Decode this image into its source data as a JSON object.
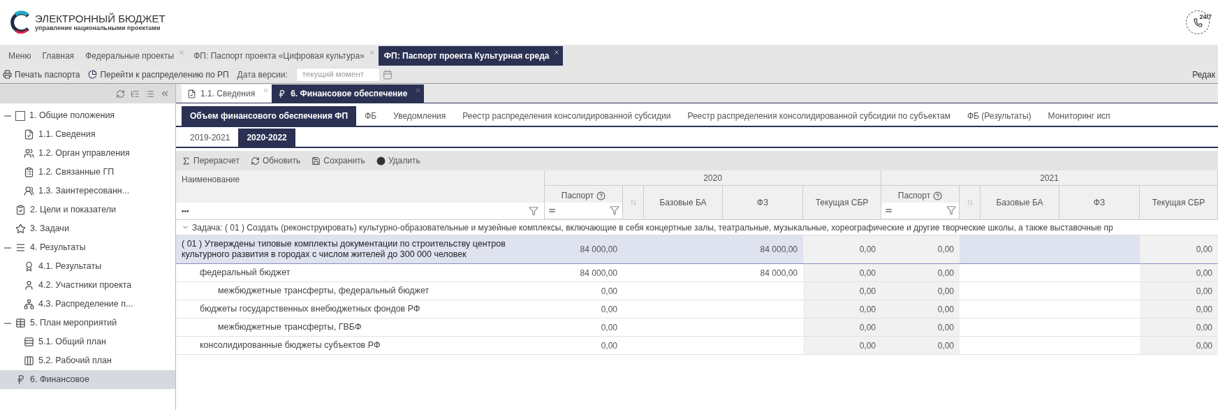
{
  "header": {
    "title": "ЭЛЕКТРОННЫЙ БЮДЖЕТ",
    "subtitle": "управление национальными проектами",
    "support_badge": "24/7"
  },
  "top_tabs": [
    {
      "label": "Меню",
      "selected": false,
      "closable": false
    },
    {
      "label": "Главная",
      "selected": false,
      "closable": false
    },
    {
      "label": "Федеральные проекты",
      "selected": false,
      "closable": true
    },
    {
      "label": "ФП: Паспорт проекта «Цифровая культура»",
      "selected": false,
      "closable": true
    },
    {
      "label": "ФП: Паспорт проекта Культурная среда",
      "selected": true,
      "closable": true
    }
  ],
  "toolbar": {
    "print": "Печать паспорта",
    "goto": "Перейти к распределению по РП",
    "version_label": "Дата версии:",
    "version_value": "текущий момент",
    "right_cut": "Редак"
  },
  "sidebar": {
    "items": [
      {
        "label": "1. Общие положения",
        "expanded": true,
        "selected": false,
        "children": [
          {
            "label": "1.1. Сведения",
            "selected": false
          },
          {
            "label": "1.2. Орган управления",
            "selected": false
          },
          {
            "label": "1.2. Связанные ГП",
            "selected": false
          },
          {
            "label": "1.3. Заинтересованн...",
            "selected": false
          }
        ]
      },
      {
        "label": "2. Цели и показатели",
        "selected": false
      },
      {
        "label": "3. Задачи",
        "selected": false
      },
      {
        "label": "4. Результаты",
        "expanded": true,
        "selected": false,
        "children": [
          {
            "label": "4.1. Результаты",
            "selected": false
          },
          {
            "label": "4.2. Участники проекта",
            "selected": false
          },
          {
            "label": "4.3. Распределение п...",
            "selected": false
          }
        ]
      },
      {
        "label": "5. План мероприятий",
        "expanded": true,
        "selected": false,
        "children": [
          {
            "label": "5.1. Общий план",
            "selected": false
          },
          {
            "label": "5.2. Рабочий план",
            "selected": false
          }
        ]
      },
      {
        "label": "6. Финансовое",
        "selected": true
      }
    ]
  },
  "content_tabs": [
    {
      "label": "1.1. Сведения",
      "selected": false
    },
    {
      "label": "6. Финансовое обеспечение",
      "selected": true
    }
  ],
  "section_tabs": [
    {
      "label": "Объем финансового обеспечения ФП",
      "selected": true
    },
    {
      "label": "ФБ",
      "selected": false
    },
    {
      "label": "Уведомления",
      "selected": false
    },
    {
      "label": "Реестр распределения консолидированной субсидии",
      "selected": false
    },
    {
      "label": "Реестр распределения консолидированной субсидии по субъектам",
      "selected": false
    },
    {
      "label": "ФБ (Результаты)",
      "selected": false
    },
    {
      "label": "Мониторинг исп",
      "selected": false
    }
  ],
  "period_tabs": [
    {
      "label": "2019-2021",
      "selected": false
    },
    {
      "label": "2020-2022",
      "selected": true
    }
  ],
  "table_toolbar": [
    "Перерасчет",
    "Обновить",
    "Сохранить",
    "Удалить"
  ],
  "table": {
    "name_column": "Наименование",
    "filter_menu": "•••",
    "years": [
      {
        "label": "2020",
        "columns": [
          {
            "label": "Паспорт",
            "kind": "filterable"
          },
          {
            "label": "Базовые БА",
            "kind": "plain"
          },
          {
            "label": "ФЗ",
            "kind": "plain"
          },
          {
            "label": "Текущая СБР",
            "kind": "plain"
          }
        ]
      },
      {
        "label": "2021",
        "columns": [
          {
            "label": "Паспорт",
            "kind": "filterable"
          },
          {
            "label": "Базовые БА",
            "kind": "plain"
          },
          {
            "label": "ФЗ",
            "kind": "plain"
          },
          {
            "label": "Текущая СБР",
            "kind": "plain"
          }
        ]
      }
    ],
    "group": {
      "label": "Задача: ( 01 ) Создать (реконструировать) культурно-образовательные и музейные комплексы, включающие в себя концертные залы, театральные, музыкальные, хореографические и другие творческие школы, а также выставочные пр",
      "expanded": true
    },
    "rows": [
      {
        "name": "( 01 ) Утверждены типовые комплекты документации по строительству центров культурного развития в городах с числом жителей до 300 000 человек",
        "selected": true,
        "values": {
          "passport_2020": "84 000,00",
          "fz_2020": "84 000,00",
          "sbr_2020": "0,00",
          "passport_2021": "0,00",
          "sbr_2021": "0,00"
        },
        "children": [
          {
            "name": "федеральный бюджет",
            "selected": false,
            "values": {
              "passport_2020": "84 000,00",
              "fz_2020": "84 000,00",
              "sbr_2020": "0,00",
              "passport_2021": "0,00",
              "sbr_2021": "0,00"
            },
            "children": [
              {
                "name": "межбюджетные трансферты, федеральный бюджет",
                "selected": false,
                "values": {
                  "passport_2020": "0,00",
                  "sbr_2020": "0,00",
                  "passport_2021": "0,00",
                  "sbr_2021": "0,00"
                }
              }
            ]
          },
          {
            "name": "бюджеты государственных внебюджетных фондов РФ",
            "selected": false,
            "values": {
              "passport_2020": "0,00",
              "sbr_2020": "0,00",
              "passport_2021": "0,00",
              "sbr_2021": "0,00"
            },
            "children": [
              {
                "name": "межбюджетные трансферты, ГВБФ",
                "selected": false,
                "values": {
                  "passport_2020": "0,00",
                  "sbr_2020": "0,00",
                  "passport_2021": "0,00",
                  "sbr_2021": "0,00"
                }
              }
            ]
          },
          {
            "name": "консолидированные бюджеты субъектов РФ",
            "selected": false,
            "values": {
              "passport_2020": "0,00",
              "sbr_2020": "0,00",
              "passport_2021": "0,00",
              "sbr_2021": "0,00"
            }
          }
        ]
      }
    ]
  }
}
